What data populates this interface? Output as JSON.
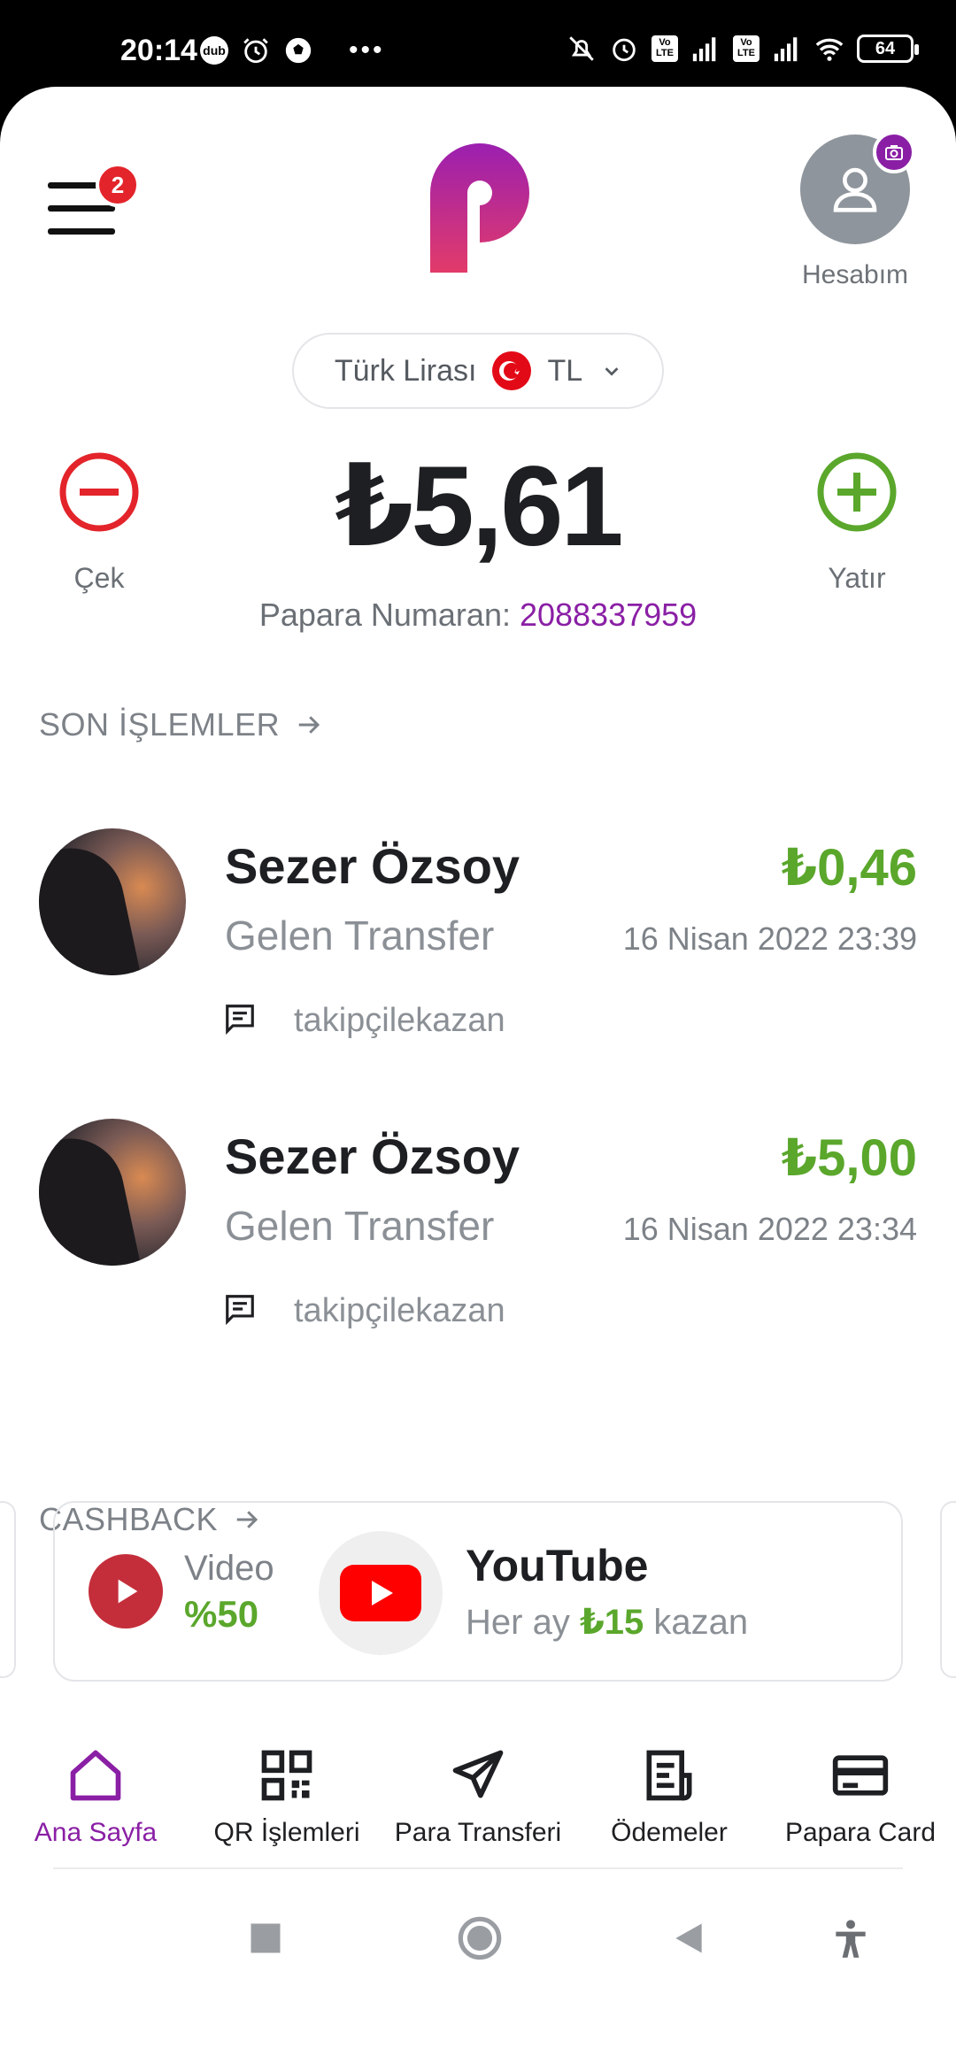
{
  "status_bar": {
    "time": "20:14",
    "left_badge": "dub",
    "battery": "64",
    "lte1": "Vo LTE",
    "lte2": "Vo LTE",
    "icons": [
      "dub-icon",
      "alarm-icon",
      "soccer-ball-icon",
      "more-dots-icon",
      "silent-icon",
      "alarm-icon",
      "signal-icon",
      "signal-icon",
      "wifi-icon",
      "battery-icon"
    ]
  },
  "header": {
    "menu_badge": "2",
    "account_label": "Hesabım",
    "brand_color": "#8a1fa5"
  },
  "currency": {
    "name": "Türk Lirası",
    "code": "TL"
  },
  "balance": {
    "amount": "₺5,61",
    "withdraw_label": "Çek",
    "deposit_label": "Yatır",
    "number_label": "Papara Numaran:",
    "number_value": "2088337959"
  },
  "recent": {
    "title": "SON İŞLEMLER",
    "transactions": [
      {
        "name": "Sezer Özsoy",
        "type": "Gelen Transfer",
        "amount": "₺0,46",
        "date": "16 Nisan 2022 23:39",
        "note": "takipçilekazan"
      },
      {
        "name": "Sezer Özsoy",
        "type": "Gelen Transfer",
        "amount": "₺5,00",
        "date": "16 Nisan 2022 23:34",
        "note": "takipçilekazan"
      }
    ]
  },
  "cashback": {
    "title": "CASHBACK",
    "card": {
      "category": "Video",
      "rate": "%50",
      "brand": "YouTube",
      "offer_prefix": "Her ay",
      "offer_amount": "₺15",
      "offer_suffix": "kazan"
    }
  },
  "bottom_nav": {
    "items": [
      {
        "label": "Ana Sayfa",
        "icon": "home-icon",
        "active": true
      },
      {
        "label": "QR İşlemleri",
        "icon": "qr-code-icon",
        "active": false
      },
      {
        "label": "Para Transferi",
        "icon": "send-icon",
        "active": false
      },
      {
        "label": "Ödemeler",
        "icon": "receipt-icon",
        "active": false
      },
      {
        "label": "Papara Card",
        "icon": "credit-card-icon",
        "active": false
      }
    ]
  },
  "colors": {
    "accent_purple": "#8a1fa5",
    "positive_green": "#5aa72c",
    "negative_red": "#e3242b"
  }
}
